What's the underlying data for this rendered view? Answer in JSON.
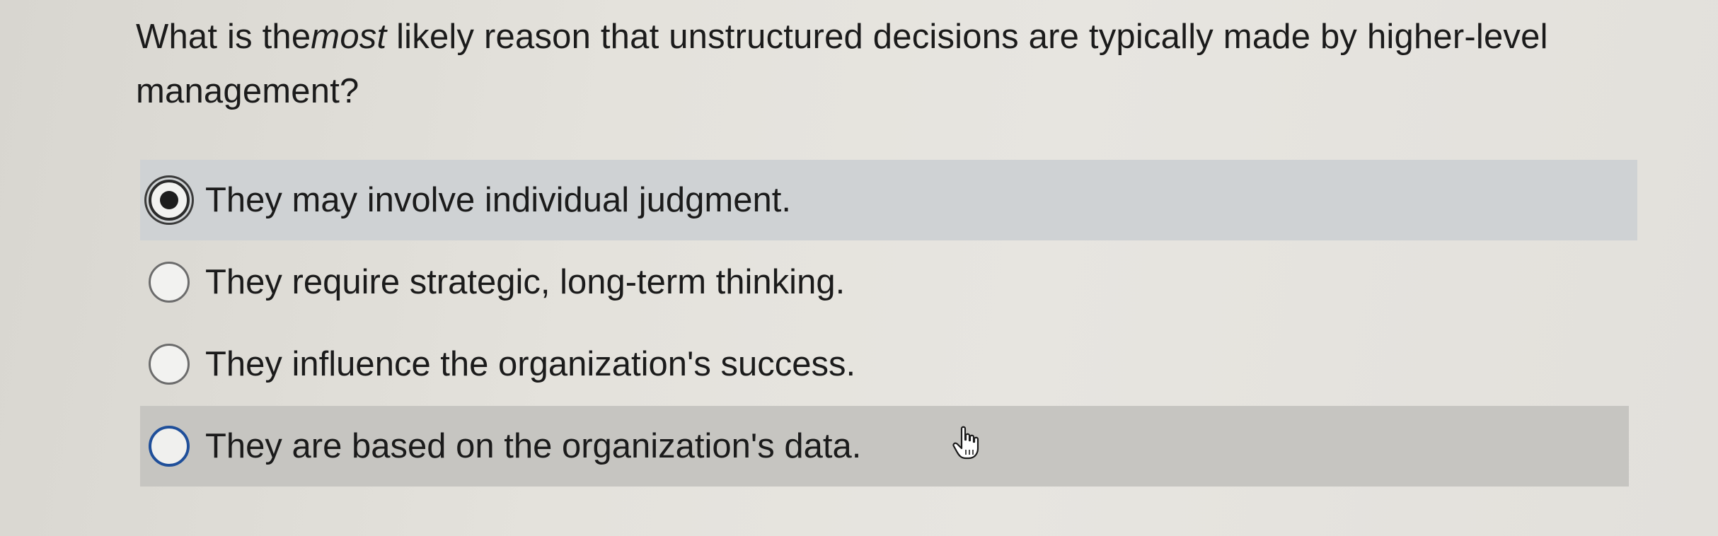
{
  "question": {
    "prefix": "What is the",
    "emphasis": "most",
    "suffix": " likely reason that unstructured decisions are typically made by higher-level management?"
  },
  "choices": [
    {
      "label": "They may involve individual judgment.",
      "selected": true
    },
    {
      "label": "They require strategic, long-term thinking.",
      "selected": false
    },
    {
      "label": "They influence the organization's success.",
      "selected": false
    },
    {
      "label": "They are based on the organization's data.",
      "selected": false
    }
  ],
  "colors": {
    "selected_row": "#cfd2d4",
    "hover_row": "#c6c5c1",
    "focus_ring": "#1f4f9a"
  }
}
